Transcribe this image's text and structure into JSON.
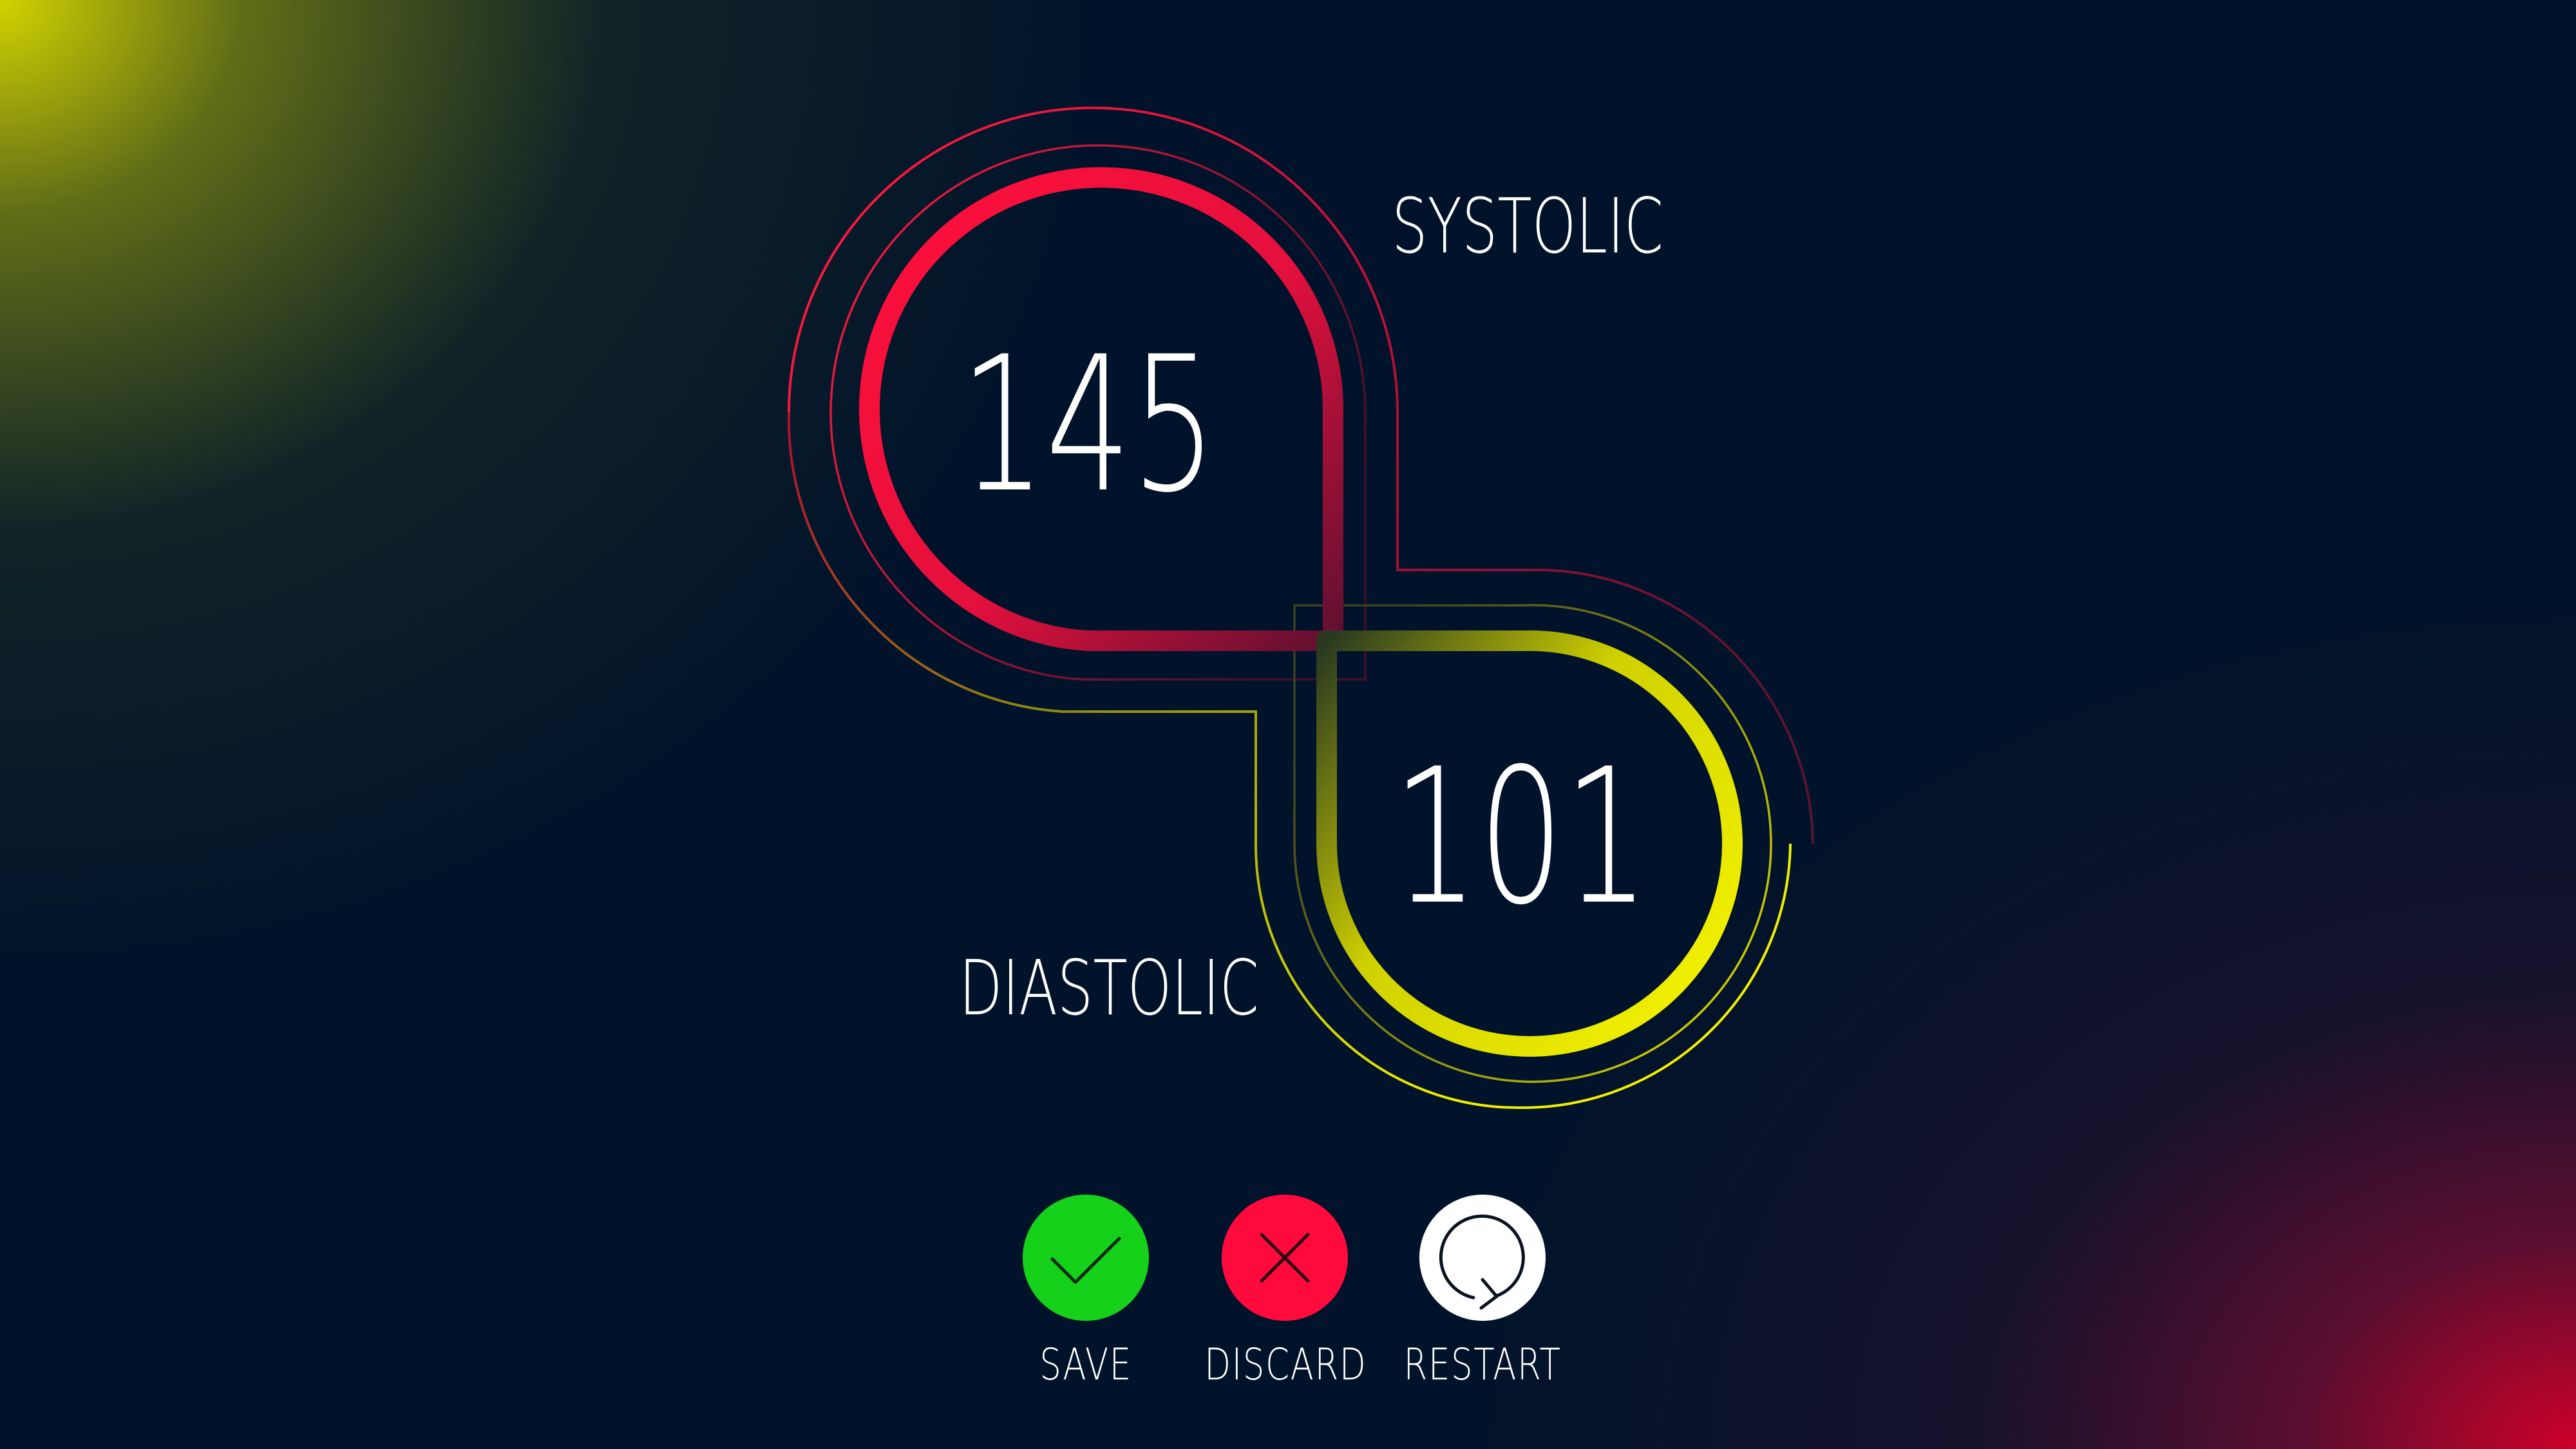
{
  "colors": {
    "systolic_accent": "#ff0f3a",
    "diastolic_accent": "#e8e800",
    "save_button": "#16d11a",
    "discard_button": "#ff0a3c",
    "restart_button": "#ffffff",
    "background": "#01132a"
  },
  "systolic": {
    "label": "SYSTOLIC",
    "value": "145"
  },
  "diastolic": {
    "label": "DIASTOLIC",
    "value": "101"
  },
  "actions": {
    "save": {
      "label": "SAVE",
      "icon": "checkmark-icon"
    },
    "discard": {
      "label": "DISCARD",
      "icon": "close-icon"
    },
    "restart": {
      "label": "RESTART",
      "icon": "restart-icon"
    }
  }
}
